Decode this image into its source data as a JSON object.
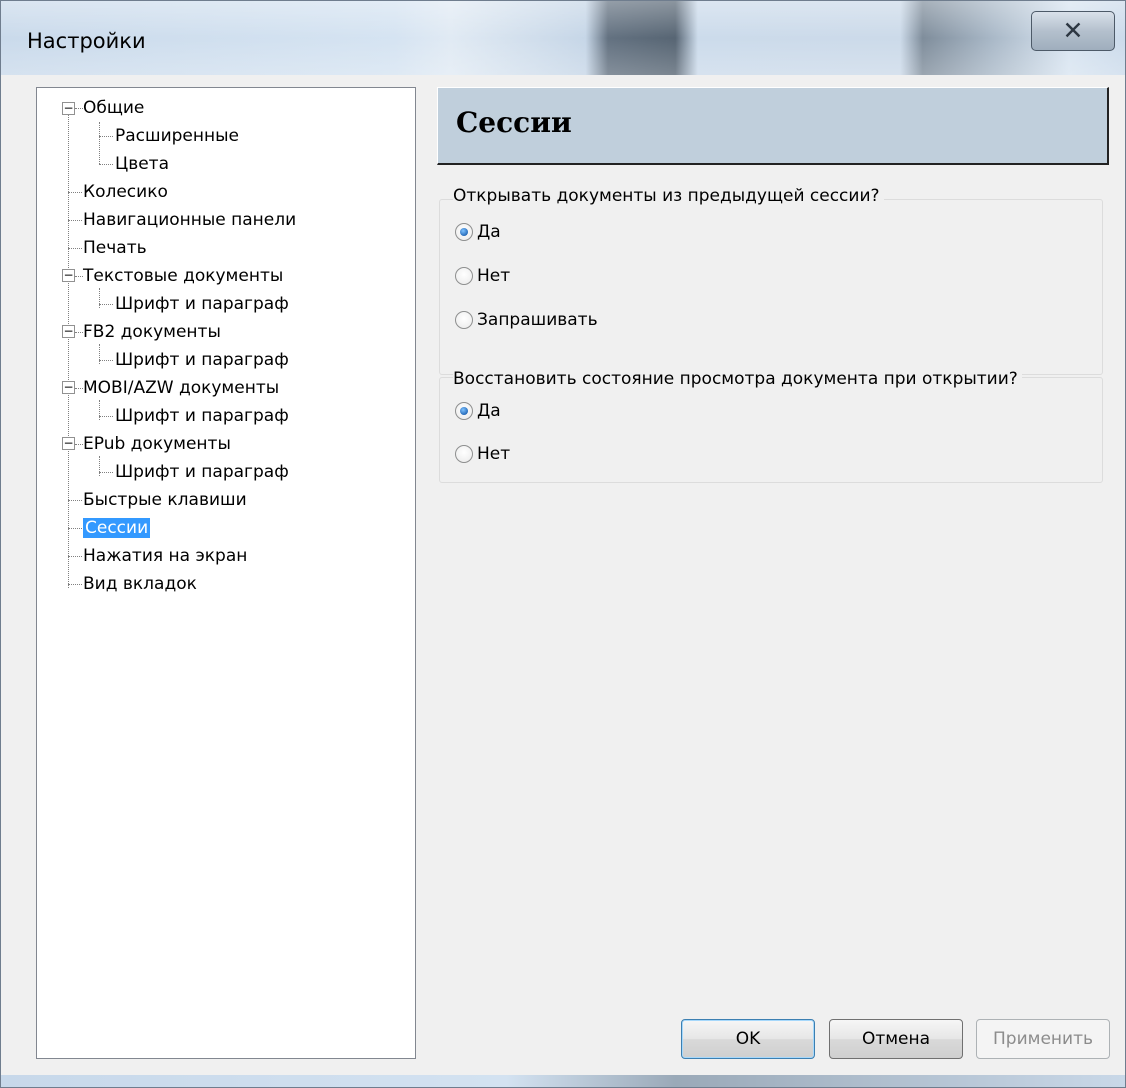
{
  "window": {
    "title": "Настройки",
    "close_icon": "close-icon"
  },
  "tree": {
    "items": [
      {
        "label": "Общие",
        "level": 0,
        "expandable": true
      },
      {
        "label": "Расширенные",
        "level": 1
      },
      {
        "label": "Цвета",
        "level": 1
      },
      {
        "label": "Колесико",
        "level": 0
      },
      {
        "label": "Навигационные панели",
        "level": 0
      },
      {
        "label": "Печать",
        "level": 0
      },
      {
        "label": "Текстовые документы",
        "level": 0,
        "expandable": true
      },
      {
        "label": "Шрифт и параграф",
        "level": 1
      },
      {
        "label": "FB2 документы",
        "level": 0,
        "expandable": true
      },
      {
        "label": "Шрифт и параграф",
        "level": 1
      },
      {
        "label": "MOBI/AZW документы",
        "level": 0,
        "expandable": true
      },
      {
        "label": "Шрифт и параграф",
        "level": 1
      },
      {
        "label": "EPub документы",
        "level": 0,
        "expandable": true
      },
      {
        "label": "Шрифт и параграф",
        "level": 1
      },
      {
        "label": "Быстрые клавиши",
        "level": 0
      },
      {
        "label": "Сессии",
        "level": 0,
        "selected": true
      },
      {
        "label": "Нажатия на экран",
        "level": 0
      },
      {
        "label": "Вид вкладок",
        "level": 0
      }
    ]
  },
  "panel": {
    "header": "Сессии",
    "group1": {
      "label": "Открывать документы из предыдущей сессии?",
      "options": [
        "Да",
        "Нет",
        "Запрашивать"
      ],
      "selected": "Да"
    },
    "group2": {
      "label": "Восстановить состояние просмотра документа при открытии?",
      "options": [
        "Да",
        "Нет"
      ],
      "selected": "Да"
    }
  },
  "buttons": {
    "ok": "OK",
    "cancel": "Отмена",
    "apply": "Применить"
  }
}
